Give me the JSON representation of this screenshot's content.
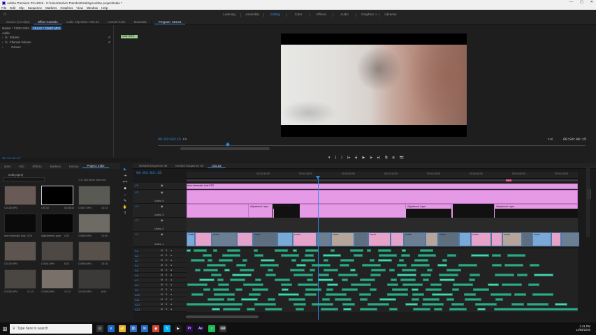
{
  "window": {
    "title": "Adobe Premiere Pro 2019 - C:\\Users\\Kelvin Tsambo\\Desktop\\Adobe project\\Indie *",
    "controls": [
      "—",
      "▢",
      "✕"
    ]
  },
  "menu": [
    "File",
    "Edit",
    "Clip",
    "Sequence",
    "Markers",
    "Graphics",
    "View",
    "Window",
    "Help"
  ],
  "workspaces": {
    "tabs": [
      "Learning",
      "Assembly",
      "Editing",
      "Color",
      "Effects",
      "Audio",
      "Graphics",
      "Libraries"
    ],
    "active": "Editing",
    "more": "»"
  },
  "effect_controls": {
    "tabs": [
      "Source: (no clips)",
      "Effect Controls",
      "Audio Clip Mixer: CELS2",
      "Lumetri Color",
      "Metadata"
    ],
    "active_tab": "Effect Controls",
    "master": "Master * C0067.MP4",
    "clip": "CELS2 * C0067.MP4",
    "section": "Audio",
    "effects": [
      "Volume",
      "Channel Volume",
      "Panner"
    ],
    "mini_clip": "C0067.MP4",
    "timecode": "00:03:03:15"
  },
  "program_monitor": {
    "title": "Program: CELS2",
    "timecode": "00:03:03:15",
    "fit": "Fit",
    "quality": "Full",
    "duration": "00:04:49:15",
    "transport": [
      "▾",
      "{",
      "}",
      "|◂",
      "◂|",
      "▶",
      "|▸",
      "▸|",
      "⧉",
      "⧈",
      "📷"
    ]
  },
  "project": {
    "tabs": [
      "aries",
      "Info",
      "Effects",
      "Markers",
      "History",
      "Project: Indie"
    ],
    "active_tab": "Project: Indie",
    "bin": "Indie.prproj",
    "selection": "1 of 168 items selected",
    "items": [
      {
        "name": "C0128.MP4",
        "duration": "",
        "tone": "#6a5a55"
      },
      {
        "name": "CELS2",
        "duration": "03:08:15",
        "tone": "#000000"
      },
      {
        "name": "C0007.MP4",
        "duration": "14:13",
        "tone": "#5a5a55"
      },
      {
        "name": "new cinematic look...",
        "duration": "0:24",
        "tone": "#0a0a0a"
      },
      {
        "name": "Adjustment Layer",
        "duration": "4:24",
        "tone": "#050505"
      },
      {
        "name": "C0040.MP4",
        "duration": "13:00",
        "tone": "#6e6a64"
      },
      {
        "name": "C0130.MP4",
        "duration": "",
        "tone": "#5e5550"
      },
      {
        "name": "C0041.MP4",
        "duration": "8:23",
        "tone": "#4d4843"
      },
      {
        "name": "C0058.MP4",
        "duration": "15:15",
        "tone": "#58504a"
      },
      {
        "name": "C0155.MP4",
        "duration": "11:13",
        "tone": "#4a4642"
      },
      {
        "name": "C0045.MP4",
        "duration": "12:13",
        "tone": "#7a706a"
      },
      {
        "name": "C0106.MP4",
        "duration": "8:09",
        "tone": "#3c3a38"
      }
    ]
  },
  "timeline": {
    "tabs": [
      "Nested Sequence 09",
      "Nested Sequence 03",
      "CELS2"
    ],
    "active_tab": "CELS2",
    "timecode": "00:03:03:15",
    "ruler": [
      "00:02:30:00",
      "00:02:45:00",
      "00:03:00:00",
      "00:03:15:00",
      "00:03:30:00",
      "00:03:45:00",
      "00:04:00:00",
      "00:04:15:00",
      "00:04:30:00"
    ],
    "video_tracks": [
      {
        "name": "V6",
        "label": "",
        "height": 10
      },
      {
        "name": "V5",
        "label": "Video 4",
        "height": 20
      },
      {
        "name": "V4",
        "label": "Video 3",
        "height": 20
      },
      {
        "name": "V3",
        "label": "Video 2",
        "height": 20
      },
      {
        "name": "V1",
        "label": "Video 1",
        "height": 22
      }
    ],
    "audio_tracks": [
      "A1",
      "A2",
      "A3",
      "A4",
      "A5",
      "A6",
      "A7",
      "A8",
      "A9",
      "A10",
      "A11",
      "A12",
      "A13"
    ],
    "v6_clip": "new cinematic look PS2",
    "adjustment_label": "Adjustment Layer",
    "video_clip_labels": [
      "C0089",
      "C0130",
      "C0100",
      "C0125",
      "C0041",
      "C0129",
      "C0058",
      "C0102",
      "C0155",
      "C0040",
      "C0021"
    ]
  },
  "taskbar": {
    "search_placeholder": "Type here to search",
    "apps": [
      "⊡",
      "e",
      "📁",
      "🛍",
      "✉",
      "◉",
      "S",
      "▶",
      "Pr",
      "Ae",
      "♫",
      "⌨"
    ],
    "time": "1:41 PM",
    "date": "14/05/2020"
  },
  "colors": {
    "accent": "#2d8ceb",
    "adjustment": "#e59ae5",
    "video_clip": "#7aa9d8",
    "audio_clip": "#2ea885"
  }
}
